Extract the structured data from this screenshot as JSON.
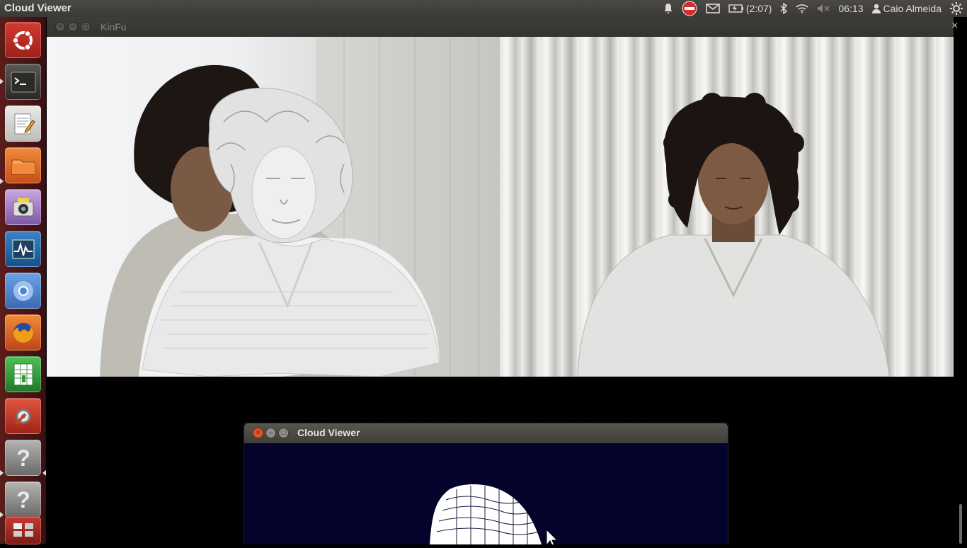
{
  "topbar": {
    "app_title": "Cloud Viewer",
    "battery_text": "(2:07)",
    "clock": "06:13",
    "user_name": "Caio Almeida"
  },
  "launcher": {
    "items": [
      {
        "name": "dash-home",
        "icon": "ubuntu-logo-icon",
        "color": "#c7312b"
      },
      {
        "name": "terminal",
        "icon": "terminal-icon",
        "color": "#3c3b37"
      },
      {
        "name": "text-editor",
        "icon": "text-editor-icon",
        "color": "#d8d8d6"
      },
      {
        "name": "files",
        "icon": "folder-icon",
        "color": "#e86a24"
      },
      {
        "name": "cheese-webcam",
        "icon": "webcam-icon",
        "color": "#a07ec0"
      },
      {
        "name": "system-monitor",
        "icon": "system-monitor-icon",
        "color": "#2a6aa8"
      },
      {
        "name": "chromium",
        "icon": "chromium-icon",
        "color": "#5b8fd6"
      },
      {
        "name": "firefox",
        "icon": "firefox-icon",
        "color": "#e66a1a"
      },
      {
        "name": "libreoffice-calc",
        "icon": "spreadsheet-icon",
        "color": "#2f9a3a"
      },
      {
        "name": "system-settings",
        "icon": "settings-icon",
        "color": "#c93f2d"
      },
      {
        "name": "unknown-app-1",
        "icon": "question-icon",
        "color": "#8e8e8e"
      },
      {
        "name": "unknown-app-2",
        "icon": "question-icon",
        "color": "#8e8e8e"
      },
      {
        "name": "workspace-switcher",
        "icon": "workspace-icon",
        "color": "#b03028"
      }
    ]
  },
  "kinfu_window": {
    "title": "KinFu",
    "left_panel": "kinfu-scan-view",
    "right_panel": "rgb-camera-view"
  },
  "cloud_viewer_window": {
    "title": "Cloud Viewer",
    "background": "#03032b"
  },
  "colors": {
    "panel_bg": "#3c3b37",
    "launcher_bg": "#4a1618",
    "close_button": "#e0542a"
  }
}
